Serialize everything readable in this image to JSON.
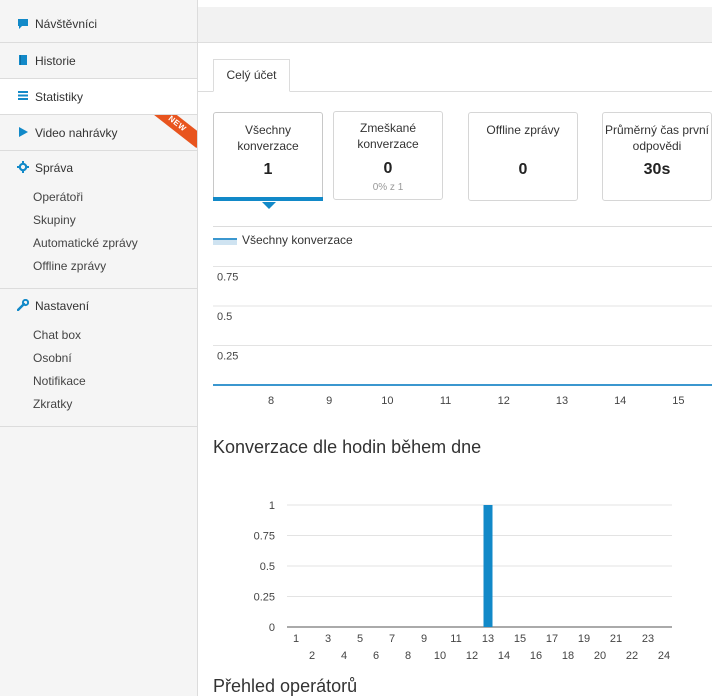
{
  "sidebar": {
    "items": [
      {
        "label": "Návštěvníci",
        "icon": "chat-bubble-icon"
      },
      {
        "label": "Historie",
        "icon": "book-icon"
      },
      {
        "label": "Statistiky",
        "icon": "list-icon"
      },
      {
        "label": "Video nahrávky",
        "icon": "play-icon",
        "badge": "NEW"
      }
    ],
    "sprava": {
      "label": "Správa",
      "icon": "gear-icon",
      "items": [
        "Operátoři",
        "Skupiny",
        "Automatické zprávy",
        "Offline zprávy"
      ]
    },
    "nastaveni": {
      "label": "Nastavení",
      "icon": "wrench-icon",
      "items": [
        "Chat box",
        "Osobní",
        "Notifikace",
        "Zkratky"
      ]
    }
  },
  "main": {
    "tab_label": "Celý účet",
    "cards": [
      {
        "label": "Všechny konverzace",
        "value": "1",
        "sub": ""
      },
      {
        "label": "Zmeškané konverzace",
        "value": "0",
        "sub": "0% z 1"
      },
      {
        "label": "Offline zprávy",
        "value": "0",
        "sub": ""
      },
      {
        "label": "Průměrný čas první odpovědi",
        "value": "30s",
        "sub": ""
      }
    ],
    "section_title": "Konverzace dle hodin během dne",
    "operators_title": "Přehled operátorů"
  },
  "colors": {
    "accent": "#1289c8",
    "ribbon": "#e8541e"
  },
  "chart_data": [
    {
      "type": "line",
      "legend": [
        "Všechny konverzace"
      ],
      "x": [
        8,
        9,
        10,
        11,
        12,
        13,
        14,
        15
      ],
      "y_ticks": [
        0.25,
        0.5,
        0.75
      ],
      "series": [
        {
          "name": "Všechny konverzace",
          "values": [
            0,
            0,
            0,
            0,
            0,
            0,
            0,
            0
          ]
        }
      ],
      "ylim": [
        0,
        1
      ]
    },
    {
      "type": "bar",
      "title": "Konverzace dle hodin během dne",
      "categories": [
        1,
        2,
        3,
        4,
        5,
        6,
        7,
        8,
        9,
        10,
        11,
        12,
        13,
        14,
        15,
        16,
        17,
        18,
        19,
        20,
        21,
        22,
        23,
        24
      ],
      "values": [
        0,
        0,
        0,
        0,
        0,
        0,
        0,
        0,
        0,
        0,
        0,
        0,
        1,
        0,
        0,
        0,
        0,
        0,
        0,
        0,
        0,
        0,
        0,
        0
      ],
      "y_ticks": [
        0,
        0.25,
        0.5,
        0.75,
        1
      ],
      "ylim": [
        0,
        1
      ],
      "grid": true
    }
  ]
}
